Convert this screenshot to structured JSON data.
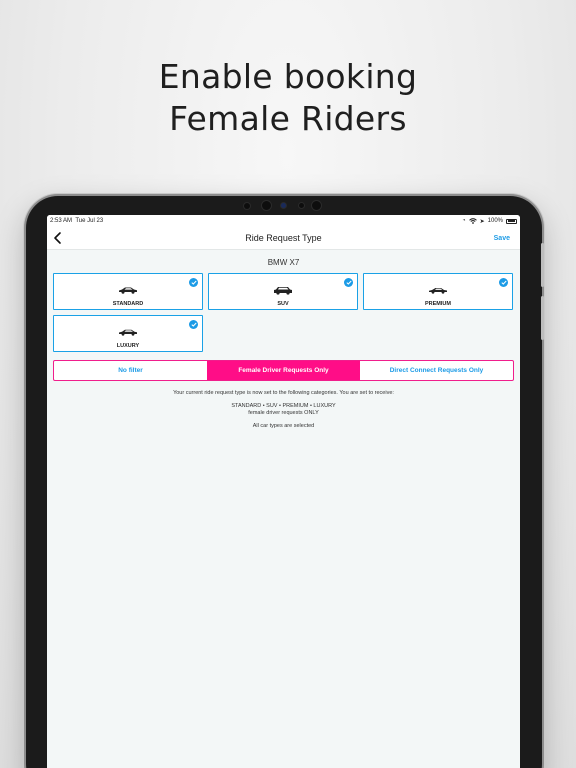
{
  "headline": {
    "line1": "Enable booking",
    "line2": "Female Riders"
  },
  "status_bar": {
    "time": "2:53 AM",
    "date": "Tue Jul 23",
    "battery": "100%"
  },
  "nav": {
    "title": "Ride Request Type",
    "save_label": "Save"
  },
  "car_model": "BMW X7",
  "car_types": [
    {
      "label": "STANDARD",
      "selected": true
    },
    {
      "label": "SUV",
      "selected": true
    },
    {
      "label": "PREMIUM",
      "selected": true
    },
    {
      "label": "LUXURY",
      "selected": true
    }
  ],
  "filters": [
    {
      "label": "No filter",
      "active": false
    },
    {
      "label": "Female Driver Requests Only",
      "active": true
    },
    {
      "label": "Direct Connect Requests Only",
      "active": false
    }
  ],
  "info": {
    "line1": "Your current ride request type is now set to the following categories. You are set to receive:",
    "line2": "STANDARD • SUV • PREMIUM • LUXURY",
    "line3": "female driver requests ONLY",
    "line4": "All car types are selected"
  },
  "colors": {
    "accent_blue": "#1c9be6",
    "accent_pink": "#ff0d87",
    "screen_bg": "#f3f7f7"
  },
  "icons": [
    "back-chevron-icon",
    "check-icon",
    "car-icon",
    "wifi-icon",
    "location-icon",
    "battery-icon"
  ]
}
